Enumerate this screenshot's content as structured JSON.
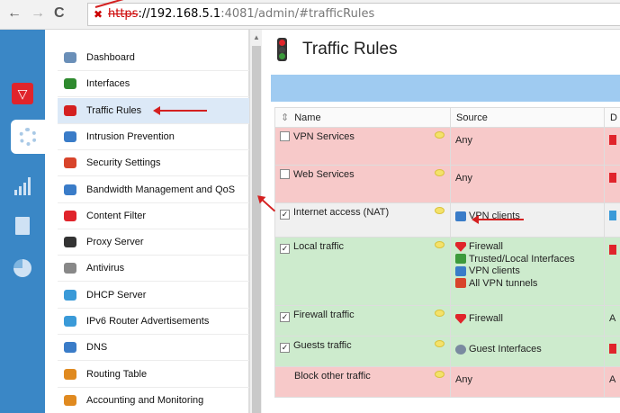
{
  "browser": {
    "back_icon": "back-arrow-icon",
    "forward_icon": "forward-arrow-icon",
    "reload_icon": "reload-icon",
    "url_scheme": "https",
    "url_host": "://192.168.5.1",
    "url_rest": ":4081/admin/#trafficRules"
  },
  "strip": {
    "items": [
      "logo-icon",
      "gear-icon",
      "bars-icon",
      "document-icon",
      "pie-icon"
    ]
  },
  "menu": {
    "items": [
      {
        "label": "Dashboard",
        "icon": "dashboard-icon",
        "color": "#6a8fb8"
      },
      {
        "label": "Interfaces",
        "icon": "interfaces-icon",
        "color": "#2f8a2f"
      },
      {
        "label": "Traffic Rules",
        "icon": "traffic-light-icon",
        "color": "#d42020",
        "active": true
      },
      {
        "label": "Intrusion Prevention",
        "icon": "shield-icon",
        "color": "#3a7cc8"
      },
      {
        "label": "Security Settings",
        "icon": "security-icon",
        "color": "#d8442b"
      },
      {
        "label": "Bandwidth Management and QoS",
        "icon": "bandwidth-icon",
        "color": "#3a7cc8"
      },
      {
        "label": "Content Filter",
        "icon": "funnel-icon",
        "color": "#e0242b"
      },
      {
        "label": "Proxy Server",
        "icon": "proxy-icon",
        "color": "#333333"
      },
      {
        "label": "Antivirus",
        "icon": "antivirus-icon",
        "color": "#888888"
      },
      {
        "label": "DHCP Server",
        "icon": "dhcp-icon",
        "color": "#3a9ad8"
      },
      {
        "label": "IPv6 Router Advertisements",
        "icon": "ipv6-icon",
        "color": "#3a9ad8"
      },
      {
        "label": "DNS",
        "icon": "dns-icon",
        "color": "#3a7cc8"
      },
      {
        "label": "Routing Table",
        "icon": "routing-icon",
        "color": "#e08a20"
      },
      {
        "label": "Accounting and Monitoring",
        "icon": "monitoring-icon",
        "color": "#e08a20"
      }
    ]
  },
  "page": {
    "title": "Traffic Rules",
    "title_icon": "traffic-light-icon"
  },
  "table": {
    "headers": {
      "name": "Name",
      "source": "Source",
      "destination": "D"
    },
    "rows": [
      {
        "name": "VPN Services",
        "checked": false,
        "color": "red",
        "sources": [
          {
            "text": "Any",
            "icon": ""
          }
        ],
        "dest": {
          "text": "",
          "icon": "firewall-icon"
        }
      },
      {
        "name": "Web Services",
        "checked": false,
        "color": "red",
        "sources": [
          {
            "text": "Any",
            "icon": ""
          }
        ],
        "dest": {
          "text": "",
          "icon": "firewall-icon"
        }
      },
      {
        "name": "Internet access (NAT)",
        "checked": true,
        "color": "grey",
        "sources": [
          {
            "text": "VPN clients",
            "icon": "vpn-clients-icon"
          }
        ],
        "dest": {
          "text": "",
          "icon": "internet-icon"
        }
      },
      {
        "name": "Local traffic",
        "checked": true,
        "color": "green",
        "sources": [
          {
            "text": "Firewall",
            "icon": "firewall-icon"
          },
          {
            "text": "Trusted/Local Interfaces",
            "icon": "interfaces-icon"
          },
          {
            "text": "VPN clients",
            "icon": "vpn-clients-icon"
          },
          {
            "text": "All VPN tunnels",
            "icon": "vpn-tunnels-icon"
          }
        ],
        "dest": {
          "text": "",
          "icon": "firewall-icon"
        }
      },
      {
        "name": "Firewall traffic",
        "checked": true,
        "color": "green",
        "sources": [
          {
            "text": "Firewall",
            "icon": "firewall-icon"
          }
        ],
        "dest": {
          "text": "A",
          "icon": ""
        }
      },
      {
        "name": "Guests traffic",
        "checked": true,
        "color": "green",
        "sources": [
          {
            "text": "Guest Interfaces",
            "icon": "guest-interfaces-icon"
          }
        ],
        "dest": {
          "text": "",
          "icon": "firewall-icon"
        }
      },
      {
        "name": "Block other traffic",
        "checked": null,
        "color": "red",
        "sources": [
          {
            "text": "Any",
            "icon": ""
          }
        ],
        "dest": {
          "text": "A",
          "icon": ""
        }
      }
    ]
  }
}
